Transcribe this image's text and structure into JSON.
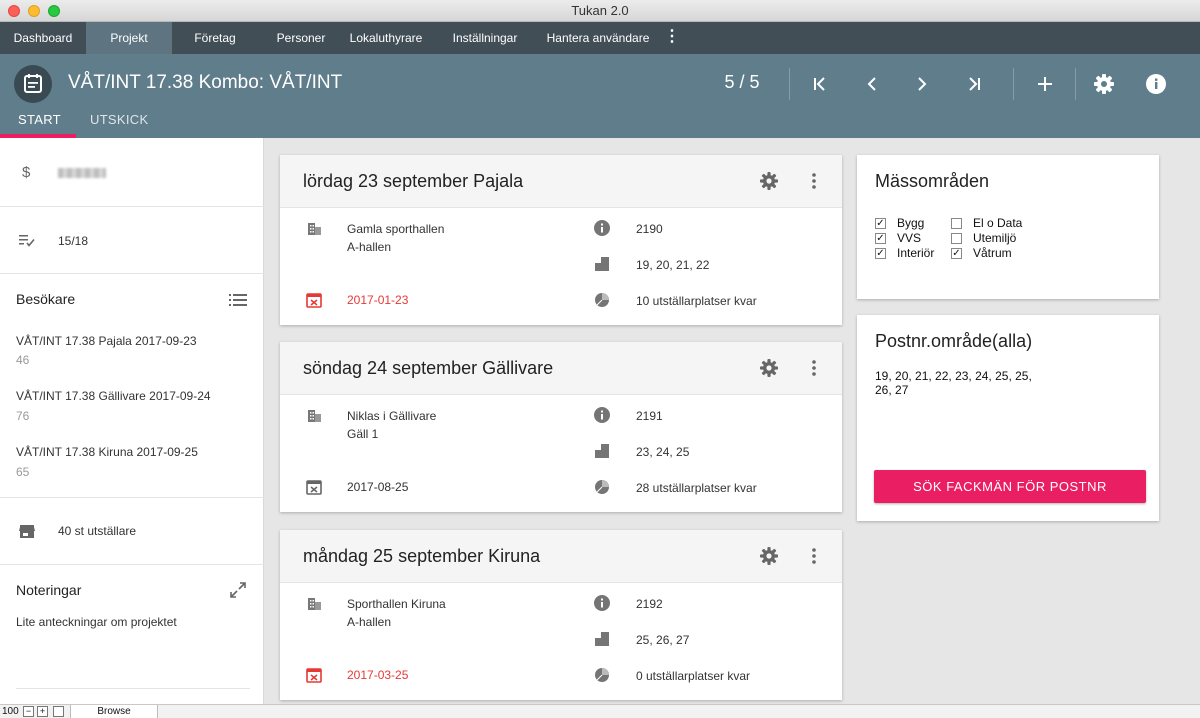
{
  "window": {
    "title": "Tukan 2.0"
  },
  "nav": {
    "items": [
      {
        "label": "Dashboard"
      },
      {
        "label": "Projekt"
      },
      {
        "label": "Företag"
      },
      {
        "label": "Personer"
      },
      {
        "label": "Lokaluthyrare"
      },
      {
        "label": "Inställningar"
      },
      {
        "label": "Hantera användare"
      }
    ],
    "active": "Projekt",
    "more": "⋮"
  },
  "header": {
    "title": "VÅT/INT 17.38 Kombo: VÅT/INT",
    "counter": "5 / 5",
    "tabs": [
      {
        "label": "START"
      },
      {
        "label": "UTSKICK"
      }
    ],
    "active_tab": "START",
    "accent_color": "#e91e63",
    "bg_color": "#607d8b"
  },
  "sidebar": {
    "progress": "15/18",
    "visitors": {
      "title": "Besökare",
      "items": [
        {
          "name": "VÅT/INT 17.38 Pajala 2017-09-23",
          "count": "46"
        },
        {
          "name": "VÅT/INT 17.38 Gällivare 2017-09-24",
          "count": "76"
        },
        {
          "name": "VÅT/INT 17.38 Kiruna 2017-09-25",
          "count": "65"
        }
      ]
    },
    "exhibitors": "40 st utställare",
    "notes": {
      "title": "Noteringar",
      "text": "Lite anteckningar om projektet"
    }
  },
  "events": [
    {
      "title": "lördag 23 september Pajala",
      "venue": "Gamla sporthallen",
      "hall": "A-hallen",
      "date": "2017-01-23",
      "date_overdue": true,
      "id": "2190",
      "zones": "19, 20, 21, 22",
      "spots": "10 utställarplatser kvar"
    },
    {
      "title": "söndag 24 september Gällivare",
      "venue": "Niklas i Gällivare",
      "hall": "Gäll 1",
      "date": "2017-08-25",
      "date_overdue": false,
      "id": "2191",
      "zones": "23, 24, 25",
      "spots": "28 utställarplatser kvar"
    },
    {
      "title": "måndag 25 september Kiruna",
      "venue": "Sporthallen Kiruna",
      "hall": "A-hallen",
      "date": "2017-03-25",
      "date_overdue": true,
      "id": "2192",
      "zones": "25, 26, 27",
      "spots": "0 utställarplatser kvar"
    }
  ],
  "fair_areas": {
    "title": "Mässområden",
    "items": [
      {
        "label": "Bygg",
        "checked": true
      },
      {
        "label": "VVS",
        "checked": true
      },
      {
        "label": "Interiör",
        "checked": true
      },
      {
        "label": "El o Data",
        "checked": false
      },
      {
        "label": "Utemiljö",
        "checked": false
      },
      {
        "label": "Våtrum",
        "checked": true
      }
    ]
  },
  "postal": {
    "title": "Postnr.område(alla)",
    "codes": "19, 20, 21, 22, 23, 24, 25, 25, 26, 27",
    "button": "SÖK FACKMÄN FÖR POSTNR"
  },
  "statusbar": {
    "zoom": "100",
    "mode": "Browse"
  }
}
